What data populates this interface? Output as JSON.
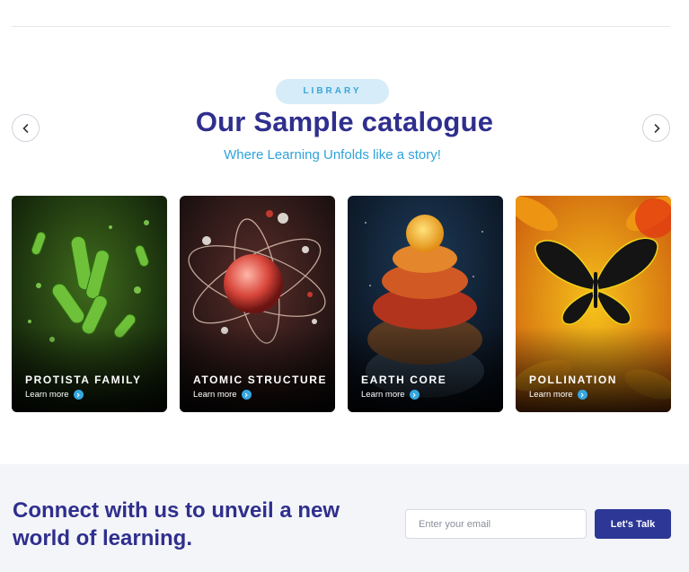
{
  "section": {
    "badge": "LIBRARY",
    "title": "Our Sample catalogue",
    "subtitle": "Where Learning Unfolds like a story!"
  },
  "carousel": {
    "prev_icon": "chevron-left-icon",
    "next_icon": "chevron-right-icon",
    "cards": [
      {
        "title": "PROTISTA FAMILY",
        "link": "Learn more",
        "image": "green-bacteria-illustration"
      },
      {
        "title": "ATOMIC STRUCTURE",
        "link": "Learn more",
        "image": "atom-orbits-illustration"
      },
      {
        "title": "EARTH CORE",
        "link": "Learn more",
        "image": "earth-layers-illustration"
      },
      {
        "title": "POLLINATION",
        "link": "Learn more",
        "image": "butterfly-flower-illustration"
      }
    ]
  },
  "footer": {
    "heading": "Connect with us to unveil a new world of learning.",
    "email_placeholder": "Enter your email",
    "button_label": "Let's Talk"
  },
  "colors": {
    "brand_navy": "#2f2f8e",
    "accent_blue": "#2ea3db",
    "button": "#2c3796",
    "footer_bg": "#f4f5f8"
  }
}
